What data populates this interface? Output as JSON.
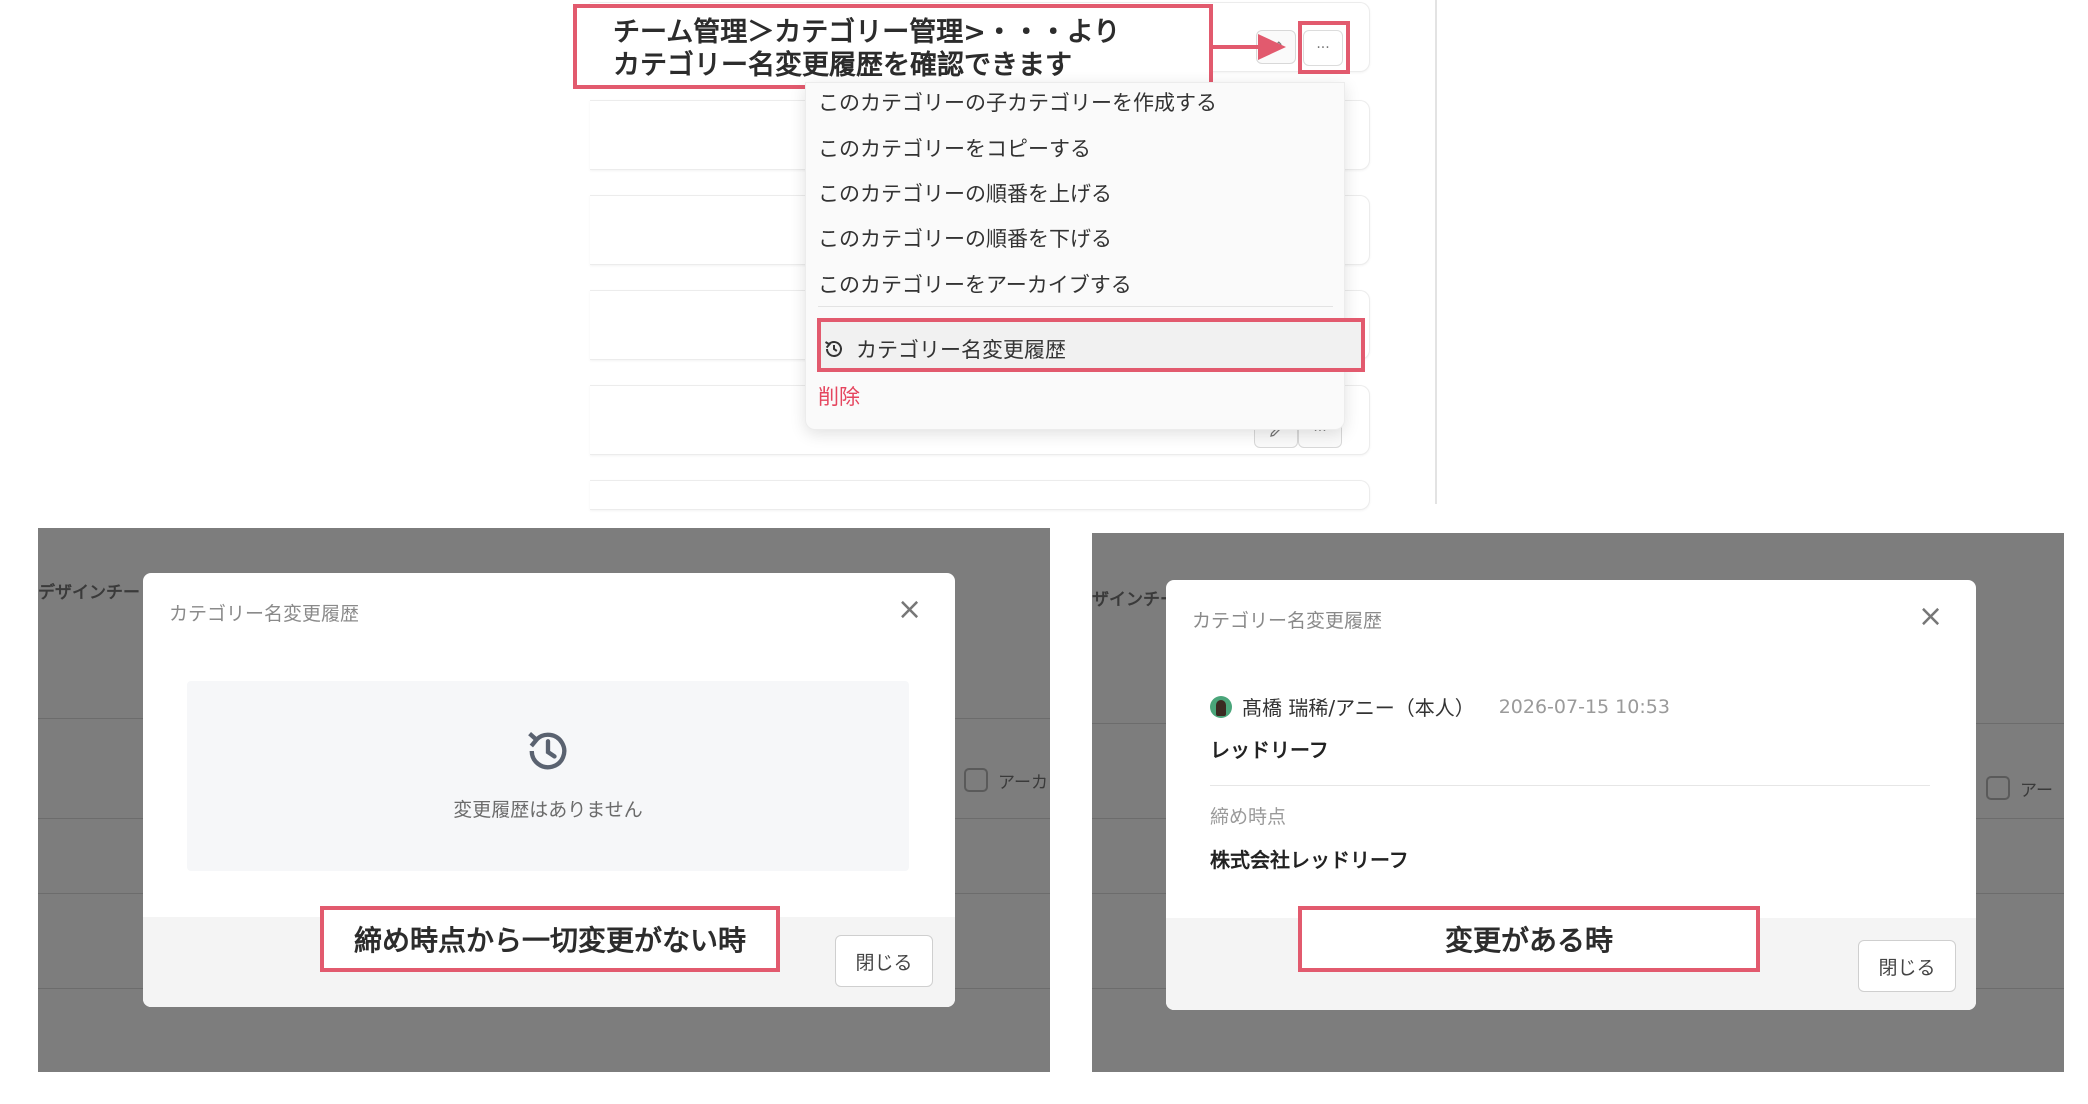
{
  "callout": {
    "line1": "チーム管理＞カテゴリー管理>・・・より",
    "line2": "カテゴリー名変更履歴を確認できます"
  },
  "more_button": "···",
  "menu": {
    "items": [
      "このカテゴリーの子カテゴリーを作成する",
      "このカテゴリーをコピーする",
      "このカテゴリーの順番を上げる",
      "このカテゴリーの順番を下げる",
      "このカテゴリーをアーカイブする"
    ],
    "history_label": "カテゴリー名変更履歴",
    "delete_label": "削除"
  },
  "background": {
    "team_label_left": "デザインチー",
    "team_label_right": "ザインチー",
    "archive_label": "アーカ",
    "archive_label_right": "アー"
  },
  "modal_empty": {
    "title": "カテゴリー名変更履歴",
    "close_icon": "×",
    "empty_text": "変更履歴はありません",
    "close_button": "閉じる",
    "annotation": "締め時点から一切変更がない時"
  },
  "modal_changed": {
    "title": "カテゴリー名変更履歴",
    "close_icon": "×",
    "user": "髙橋 瑞稀/アニー（本人）",
    "timestamp": "2026-07-15 10:53",
    "new_name": "レッドリーフ",
    "snapshot_label": "締め時点",
    "old_name": "株式会社レッドリーフ",
    "close_button": "閉じる",
    "annotation": "変更がある時"
  },
  "colors": {
    "accent": "#e25a6e",
    "danger": "#e5455e",
    "overlay": "#7d7d7d"
  }
}
